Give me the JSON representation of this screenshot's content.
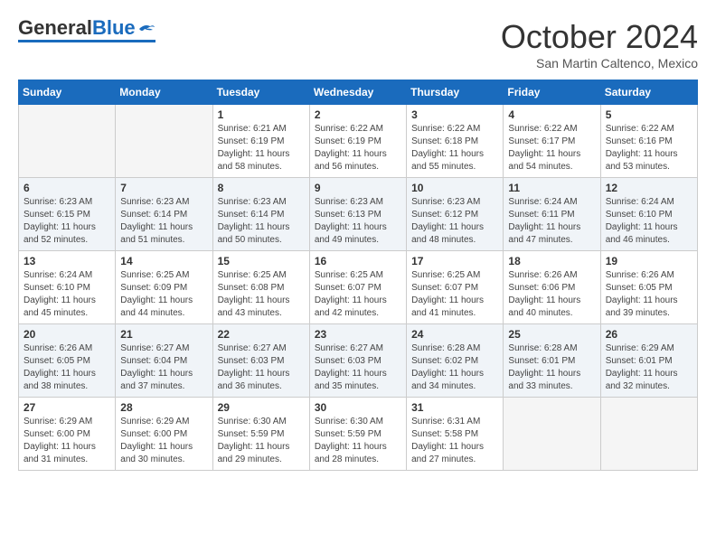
{
  "logo": {
    "general": "General",
    "blue": "Blue",
    "tagline": ""
  },
  "title": {
    "month": "October 2024",
    "location": "San Martin Caltenco, Mexico"
  },
  "headers": [
    "Sunday",
    "Monday",
    "Tuesday",
    "Wednesday",
    "Thursday",
    "Friday",
    "Saturday"
  ],
  "weeks": [
    [
      {
        "day": "",
        "info": ""
      },
      {
        "day": "",
        "info": ""
      },
      {
        "day": "1",
        "info": "Sunrise: 6:21 AM\nSunset: 6:19 PM\nDaylight: 11 hours and 58 minutes."
      },
      {
        "day": "2",
        "info": "Sunrise: 6:22 AM\nSunset: 6:19 PM\nDaylight: 11 hours and 56 minutes."
      },
      {
        "day": "3",
        "info": "Sunrise: 6:22 AM\nSunset: 6:18 PM\nDaylight: 11 hours and 55 minutes."
      },
      {
        "day": "4",
        "info": "Sunrise: 6:22 AM\nSunset: 6:17 PM\nDaylight: 11 hours and 54 minutes."
      },
      {
        "day": "5",
        "info": "Sunrise: 6:22 AM\nSunset: 6:16 PM\nDaylight: 11 hours and 53 minutes."
      }
    ],
    [
      {
        "day": "6",
        "info": "Sunrise: 6:23 AM\nSunset: 6:15 PM\nDaylight: 11 hours and 52 minutes."
      },
      {
        "day": "7",
        "info": "Sunrise: 6:23 AM\nSunset: 6:14 PM\nDaylight: 11 hours and 51 minutes."
      },
      {
        "day": "8",
        "info": "Sunrise: 6:23 AM\nSunset: 6:14 PM\nDaylight: 11 hours and 50 minutes."
      },
      {
        "day": "9",
        "info": "Sunrise: 6:23 AM\nSunset: 6:13 PM\nDaylight: 11 hours and 49 minutes."
      },
      {
        "day": "10",
        "info": "Sunrise: 6:23 AM\nSunset: 6:12 PM\nDaylight: 11 hours and 48 minutes."
      },
      {
        "day": "11",
        "info": "Sunrise: 6:24 AM\nSunset: 6:11 PM\nDaylight: 11 hours and 47 minutes."
      },
      {
        "day": "12",
        "info": "Sunrise: 6:24 AM\nSunset: 6:10 PM\nDaylight: 11 hours and 46 minutes."
      }
    ],
    [
      {
        "day": "13",
        "info": "Sunrise: 6:24 AM\nSunset: 6:10 PM\nDaylight: 11 hours and 45 minutes."
      },
      {
        "day": "14",
        "info": "Sunrise: 6:25 AM\nSunset: 6:09 PM\nDaylight: 11 hours and 44 minutes."
      },
      {
        "day": "15",
        "info": "Sunrise: 6:25 AM\nSunset: 6:08 PM\nDaylight: 11 hours and 43 minutes."
      },
      {
        "day": "16",
        "info": "Sunrise: 6:25 AM\nSunset: 6:07 PM\nDaylight: 11 hours and 42 minutes."
      },
      {
        "day": "17",
        "info": "Sunrise: 6:25 AM\nSunset: 6:07 PM\nDaylight: 11 hours and 41 minutes."
      },
      {
        "day": "18",
        "info": "Sunrise: 6:26 AM\nSunset: 6:06 PM\nDaylight: 11 hours and 40 minutes."
      },
      {
        "day": "19",
        "info": "Sunrise: 6:26 AM\nSunset: 6:05 PM\nDaylight: 11 hours and 39 minutes."
      }
    ],
    [
      {
        "day": "20",
        "info": "Sunrise: 6:26 AM\nSunset: 6:05 PM\nDaylight: 11 hours and 38 minutes."
      },
      {
        "day": "21",
        "info": "Sunrise: 6:27 AM\nSunset: 6:04 PM\nDaylight: 11 hours and 37 minutes."
      },
      {
        "day": "22",
        "info": "Sunrise: 6:27 AM\nSunset: 6:03 PM\nDaylight: 11 hours and 36 minutes."
      },
      {
        "day": "23",
        "info": "Sunrise: 6:27 AM\nSunset: 6:03 PM\nDaylight: 11 hours and 35 minutes."
      },
      {
        "day": "24",
        "info": "Sunrise: 6:28 AM\nSunset: 6:02 PM\nDaylight: 11 hours and 34 minutes."
      },
      {
        "day": "25",
        "info": "Sunrise: 6:28 AM\nSunset: 6:01 PM\nDaylight: 11 hours and 33 minutes."
      },
      {
        "day": "26",
        "info": "Sunrise: 6:29 AM\nSunset: 6:01 PM\nDaylight: 11 hours and 32 minutes."
      }
    ],
    [
      {
        "day": "27",
        "info": "Sunrise: 6:29 AM\nSunset: 6:00 PM\nDaylight: 11 hours and 31 minutes."
      },
      {
        "day": "28",
        "info": "Sunrise: 6:29 AM\nSunset: 6:00 PM\nDaylight: 11 hours and 30 minutes."
      },
      {
        "day": "29",
        "info": "Sunrise: 6:30 AM\nSunset: 5:59 PM\nDaylight: 11 hours and 29 minutes."
      },
      {
        "day": "30",
        "info": "Sunrise: 6:30 AM\nSunset: 5:59 PM\nDaylight: 11 hours and 28 minutes."
      },
      {
        "day": "31",
        "info": "Sunrise: 6:31 AM\nSunset: 5:58 PM\nDaylight: 11 hours and 27 minutes."
      },
      {
        "day": "",
        "info": ""
      },
      {
        "day": "",
        "info": ""
      }
    ]
  ]
}
